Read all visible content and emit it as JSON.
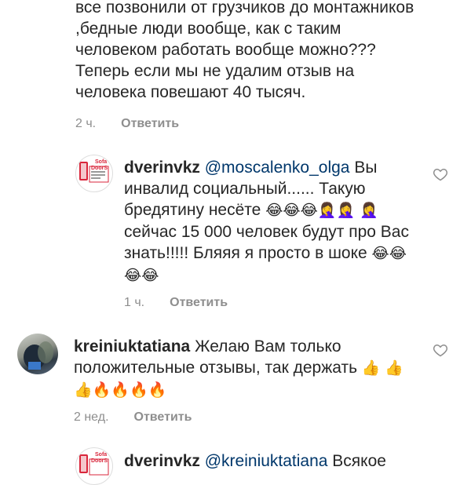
{
  "comment1": {
    "text": "все позвонили от грузчиков до монтажников ,бедные люди вообще, как с таким человеком работать вообще можно???Теперь если мы не удалим отзыв на человека повешают 40 тысяч.",
    "time": "2 ч.",
    "reply_label": "Ответить"
  },
  "reply1": {
    "username": "dverinvkz",
    "mention": "@moscalenko_olga",
    "text_a": " Вы инвалид социальный...... Такую бредятину несёте ",
    "emoji_a": "😂😂😂🤦‍♀️🤦‍♀️",
    "emoji_b": "🤦‍♀️",
    "text_b": " сейчас 15 000 человек будут про Вас знать!!!!! Бляяя я просто в шоке ",
    "emoji_c": "😂😂😂😂",
    "time": "1 ч.",
    "reply_label": "Ответить",
    "avatar_logo_line1": "Sofa",
    "avatar_logo_line2": "DoorS"
  },
  "comment2": {
    "username": "kreiniuktatiana",
    "text": " Желаю Вам только положительные отзывы, так держать ",
    "emoji_a": "👍",
    "emoji_b": "👍👍🔥🔥🔥🔥",
    "time": "2 нед.",
    "reply_label": "Ответить"
  },
  "reply2": {
    "username": "dverinvkz",
    "mention": "@kreiniuktatiana",
    "text": " Всякое",
    "avatar_logo_line1": "Sofa",
    "avatar_logo_line2": "DoorS"
  },
  "colors": {
    "text": "#262626",
    "secondary": "#8e8e8e",
    "mention": "#00376b",
    "logo_red": "#d9263b"
  }
}
